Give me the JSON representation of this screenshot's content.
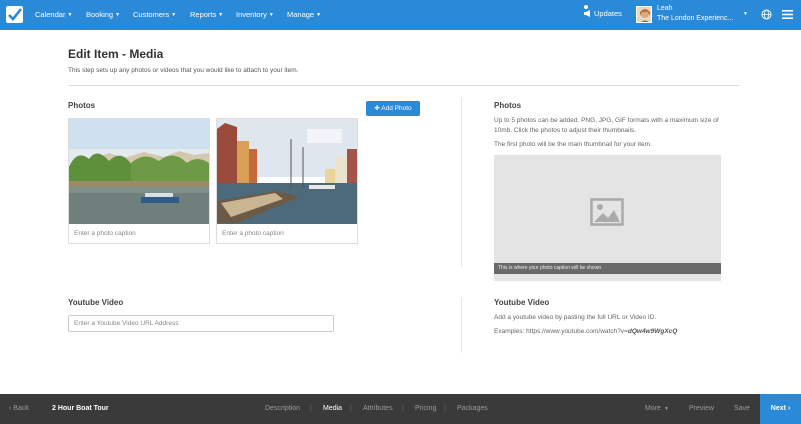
{
  "topnav": {
    "menu": [
      {
        "label": "Calendar"
      },
      {
        "label": "Booking"
      },
      {
        "label": "Customers"
      },
      {
        "label": "Reports"
      },
      {
        "label": "Inventory"
      },
      {
        "label": "Manage"
      }
    ],
    "updates_label": "Updates",
    "user_name": "Leah",
    "user_company": "The London Experienc...",
    "accent_color": "#2b8ad8"
  },
  "page": {
    "title": "Edit Item - Media",
    "subtitle": "This step sets up any photos or videos that you would like to attach to your item."
  },
  "photos": {
    "heading": "Photos",
    "add_button": "Add Photo",
    "add_icon": "plus-icon",
    "cards": [
      {
        "caption_placeholder": "Enter a photo caption"
      },
      {
        "caption_placeholder": "Enter a photo caption"
      }
    ]
  },
  "youtube": {
    "heading": "Youtube Video",
    "placeholder": "Enter a Youtube Video URL Address"
  },
  "help": {
    "photos_heading": "Photos",
    "photos_text_1": "Up to 5 photos can be added. PNG, JPG, GIF formats with a maximum size of 10mb. Click the photos to adjust their thumbnails.",
    "photos_text_2": "The first photo will be the main thumbnail for your item.",
    "preview_caption": "This is where your photo caption will be shown",
    "youtube_heading": "Youtube Video",
    "youtube_text": "Add a youtube video by pasting the full URL or Video ID.",
    "examples_prefix": "Examples: https://www.youtube.com/watch?v=",
    "examples_id": "dQw4w9WgXcQ"
  },
  "bottombar": {
    "back_label": "Back",
    "item_title": "2 Hour Boat Tour",
    "steps": [
      {
        "label": "Description"
      },
      {
        "label": "Media"
      },
      {
        "label": "Attributes"
      },
      {
        "label": "Pricing"
      },
      {
        "label": "Packages"
      }
    ],
    "more_label": "More",
    "preview_label": "Preview",
    "save_label": "Save",
    "next_label": "Next"
  }
}
